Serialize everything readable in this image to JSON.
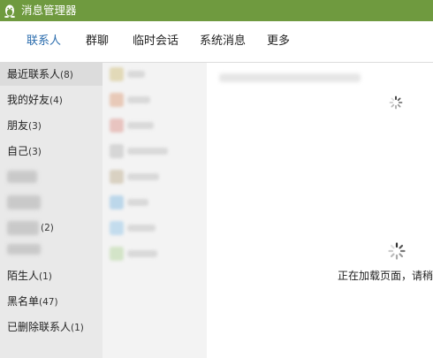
{
  "window": {
    "title": "消息管理器",
    "icon": "qq-penguin-icon"
  },
  "nav": {
    "tabs": [
      {
        "label": "联系人",
        "active": true
      },
      {
        "label": "群聊",
        "active": false
      },
      {
        "label": "临时会话",
        "active": false
      },
      {
        "label": "系统消息",
        "active": false
      },
      {
        "label": "更多",
        "active": false
      }
    ]
  },
  "sidebar": {
    "groups": [
      {
        "name": "最近联系人",
        "count": "(8)"
      },
      {
        "name": "我的好友",
        "count": "(4)"
      },
      {
        "name": "朋友",
        "count": "(3)"
      },
      {
        "name": "自己",
        "count": "(3)"
      },
      {
        "name": "",
        "count": ""
      },
      {
        "name": "",
        "count": ""
      },
      {
        "name": "",
        "count": "(2)"
      },
      {
        "name": "",
        "count": ""
      },
      {
        "name": "陌生人",
        "count": "(1)"
      },
      {
        "name": "黑名单",
        "count": "(47)"
      },
      {
        "name": "已删除联系人",
        "count": "(1)"
      }
    ]
  },
  "content": {
    "loading_text": "正在加载页面，请稍候"
  },
  "colors": {
    "titlebar": "#6f9a3f",
    "active_tab": "#2a6cad",
    "sidebar_bg": "#e9e9e9",
    "list_bg": "#f3f3f3"
  }
}
